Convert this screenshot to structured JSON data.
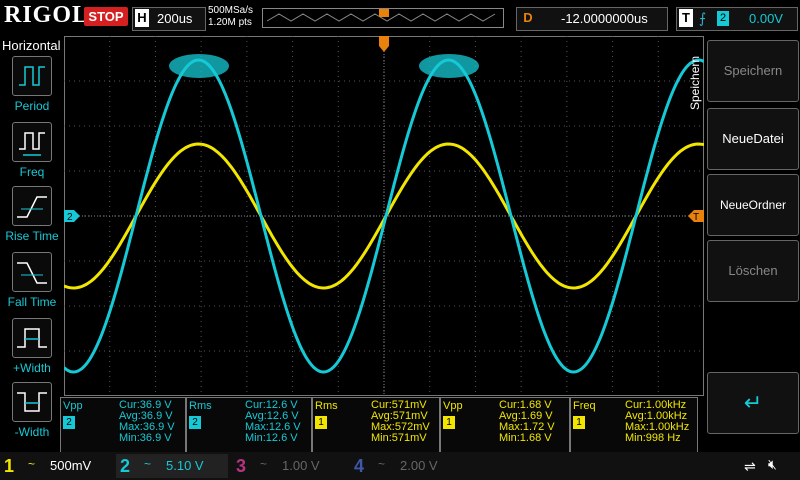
{
  "brand": "RIGOL",
  "run_state": "STOP",
  "horizontal": {
    "label": "H",
    "timebase": "200us",
    "sample_rate": "500MSa/s",
    "points": "1.20M pts"
  },
  "trigger_strip": {
    "marker": "T"
  },
  "delay": {
    "label": "D",
    "value": "-12.0000000us"
  },
  "trigger": {
    "label": "T",
    "edge_icon": "rising-edge",
    "channel": "2",
    "level": "0.00V"
  },
  "left_menu": {
    "title": "Horizontal",
    "items": [
      {
        "label": "Period",
        "icon": "period-icon"
      },
      {
        "label": "Freq",
        "icon": "freq-icon"
      },
      {
        "label": "Rise Time",
        "icon": "rise-time-icon"
      },
      {
        "label": "Fall Time",
        "icon": "fall-time-icon"
      },
      {
        "label": "+Width",
        "icon": "pos-width-icon"
      },
      {
        "label": "-Width",
        "icon": "neg-width-icon"
      }
    ]
  },
  "right_menu": {
    "title": "Speichern",
    "buttons": [
      {
        "label": "Speichern",
        "enabled": false
      },
      {
        "label": "NeueDatei",
        "enabled": true
      },
      {
        "label": "NeueOrdner",
        "enabled": true
      },
      {
        "label": "Löschen",
        "enabled": false
      },
      {
        "label": "↵",
        "enabled": true
      }
    ]
  },
  "markers": {
    "ch2_ground": "2",
    "trig_level": "T"
  },
  "measurements": [
    {
      "type": "Vpp",
      "ch": "2",
      "cur": "Cur:36.9 V",
      "avg": "Avg:36.9 V",
      "max": "Max:36.9 V",
      "min": "Min:36.9 V",
      "color": "#16c9d6"
    },
    {
      "type": "Rms",
      "ch": "2",
      "cur": "Cur:12.6 V",
      "avg": "Avg:12.6 V",
      "max": "Max:12.6 V",
      "min": "Min:12.6 V",
      "color": "#16c9d6"
    },
    {
      "type": "Rms",
      "ch": "1",
      "cur": "Cur:571mV",
      "avg": "Avg:571mV",
      "max": "Max:572mV",
      "min": "Min:571mV",
      "color": "#f2e600"
    },
    {
      "type": "Vpp",
      "ch": "1",
      "cur": "Cur:1.68 V",
      "avg": "Avg:1.69 V",
      "max": "Max:1.72 V",
      "min": "Min:1.68 V",
      "color": "#f2e600"
    },
    {
      "type": "Freq",
      "ch": "1",
      "cur": "Cur:1.00kHz",
      "avg": "Avg:1.00kHz",
      "max": "Max:1.00kHz",
      "min": "Min:998 Hz",
      "color": "#f2e600"
    }
  ],
  "channels": [
    {
      "num": "1",
      "coupling": "~",
      "scale": "500mV",
      "color": "#f2e600",
      "active": true
    },
    {
      "num": "2",
      "coupling": "~",
      "scale": "5.10 V",
      "color": "#16c9d6",
      "active": true
    },
    {
      "num": "3",
      "coupling": "~",
      "scale": "1.00 V",
      "color": "#b7337f",
      "active": false
    },
    {
      "num": "4",
      "coupling": "~",
      "scale": "2.00 V",
      "color": "#3f57a8",
      "active": false
    }
  ],
  "colors": {
    "ch1": "#f2e600",
    "ch2": "#16c9d6",
    "trigger": "#e9820c",
    "grid": "#555555"
  },
  "status_icons": [
    "usb-icon",
    "mute-icon"
  ]
}
